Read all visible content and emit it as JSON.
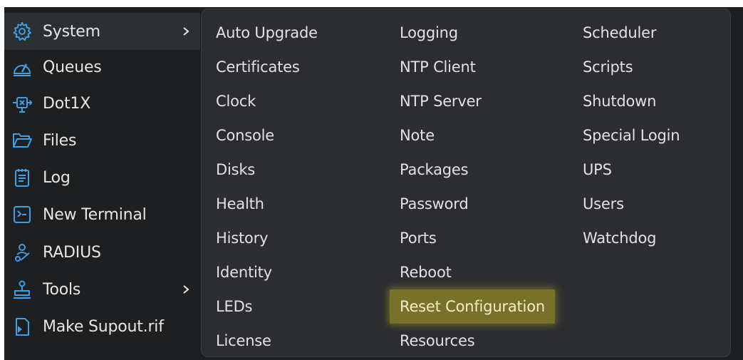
{
  "sidebar": {
    "items": [
      {
        "label": "System",
        "icon": "gear-icon",
        "active": true,
        "has_submenu": true
      },
      {
        "label": "Queues",
        "icon": "gauge-icon",
        "active": false,
        "has_submenu": false
      },
      {
        "label": "Dot1X",
        "icon": "dot1x-icon",
        "active": false,
        "has_submenu": false
      },
      {
        "label": "Files",
        "icon": "folder-icon",
        "active": false,
        "has_submenu": false
      },
      {
        "label": "Log",
        "icon": "log-icon",
        "active": false,
        "has_submenu": false
      },
      {
        "label": "New Terminal",
        "icon": "terminal-icon",
        "active": false,
        "has_submenu": false
      },
      {
        "label": "RADIUS",
        "icon": "radius-icon",
        "active": false,
        "has_submenu": false
      },
      {
        "label": "Tools",
        "icon": "tools-icon",
        "active": false,
        "has_submenu": true
      },
      {
        "label": "Make Supout.rif",
        "icon": "supout-file-icon",
        "active": false,
        "has_submenu": false
      }
    ]
  },
  "submenu": {
    "columns": [
      [
        "Auto Upgrade",
        "Certificates",
        "Clock",
        "Console",
        "Disks",
        "Health",
        "History",
        "Identity",
        "LEDs",
        "License"
      ],
      [
        "Logging",
        "NTP Client",
        "NTP Server",
        "Note",
        "Packages",
        "Password",
        "Ports",
        "Reboot",
        "Reset Configuration",
        "Resources"
      ],
      [
        "Scheduler",
        "Scripts",
        "Shutdown",
        "Special Login",
        "UPS",
        "Users",
        "Watchdog"
      ]
    ],
    "highlighted": "Reset Configuration"
  },
  "colors": {
    "background": "#1d1f21",
    "panel": "#2b2d30",
    "text": "#e2e2e2",
    "icon_accent": "#3aa0e8",
    "highlight": "#77712a"
  }
}
